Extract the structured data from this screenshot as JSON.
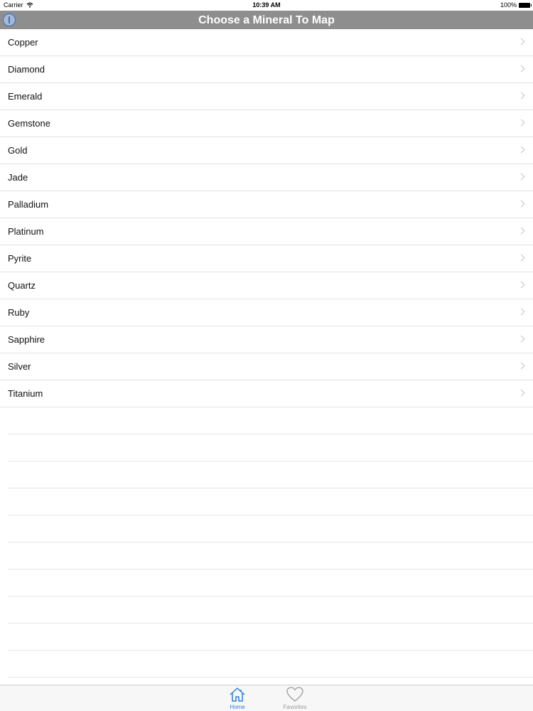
{
  "status_bar": {
    "carrier": "Carrier",
    "time": "10:39 AM",
    "battery": "100%"
  },
  "nav_bar": {
    "title": "Choose a Mineral To Map"
  },
  "minerals": [
    "Copper",
    "Diamond",
    "Emerald",
    "Gemstone",
    "Gold",
    "Jade",
    "Palladium",
    "Platinum",
    "Pyrite",
    "Quartz",
    "Ruby",
    "Sapphire",
    "Silver",
    "Titanium"
  ],
  "tab_bar": {
    "home_label": "Home",
    "favorites_label": "Favorites",
    "active_color": "#2b7fd6",
    "inactive_color": "#9a9a9a"
  }
}
